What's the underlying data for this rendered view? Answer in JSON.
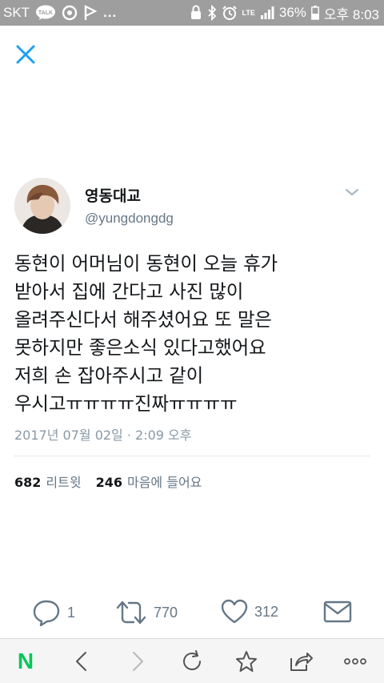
{
  "status_bar": {
    "carrier": "SKT",
    "talk_badge": "TALK",
    "more": "...",
    "network": "LTE",
    "battery": "36%",
    "time": "오후 8:03"
  },
  "tweet": {
    "display_name": "영동대교",
    "handle": "@yungdongdg",
    "text": "동현이 어머님이 동현이 오늘 휴가\n받아서 집에 간다고 사진 많이\n올려주신다서 해주셨어요 또 말은\n못하지만 좋은소식 있다고했어요\n저희 손 잡아주시고 같이\n우시고ㅠㅠㅠㅠ진짜ㅠㅠㅠㅠ",
    "timestamp": "2017년 07월 02일 · 2:09 오후",
    "retweets_count": "682",
    "retweets_label": "리트윗",
    "likes_count": "246",
    "likes_label": "마음에 들어요"
  },
  "actions": {
    "reply_count": "1",
    "retweet_count": "770",
    "like_count": "312"
  },
  "browser": {
    "home_logo": "N"
  },
  "colors": {
    "accent": "#1da1f2",
    "status_bar": "#9e9e9e",
    "naver_green": "#03c75a",
    "icon_gray": "#657786"
  }
}
